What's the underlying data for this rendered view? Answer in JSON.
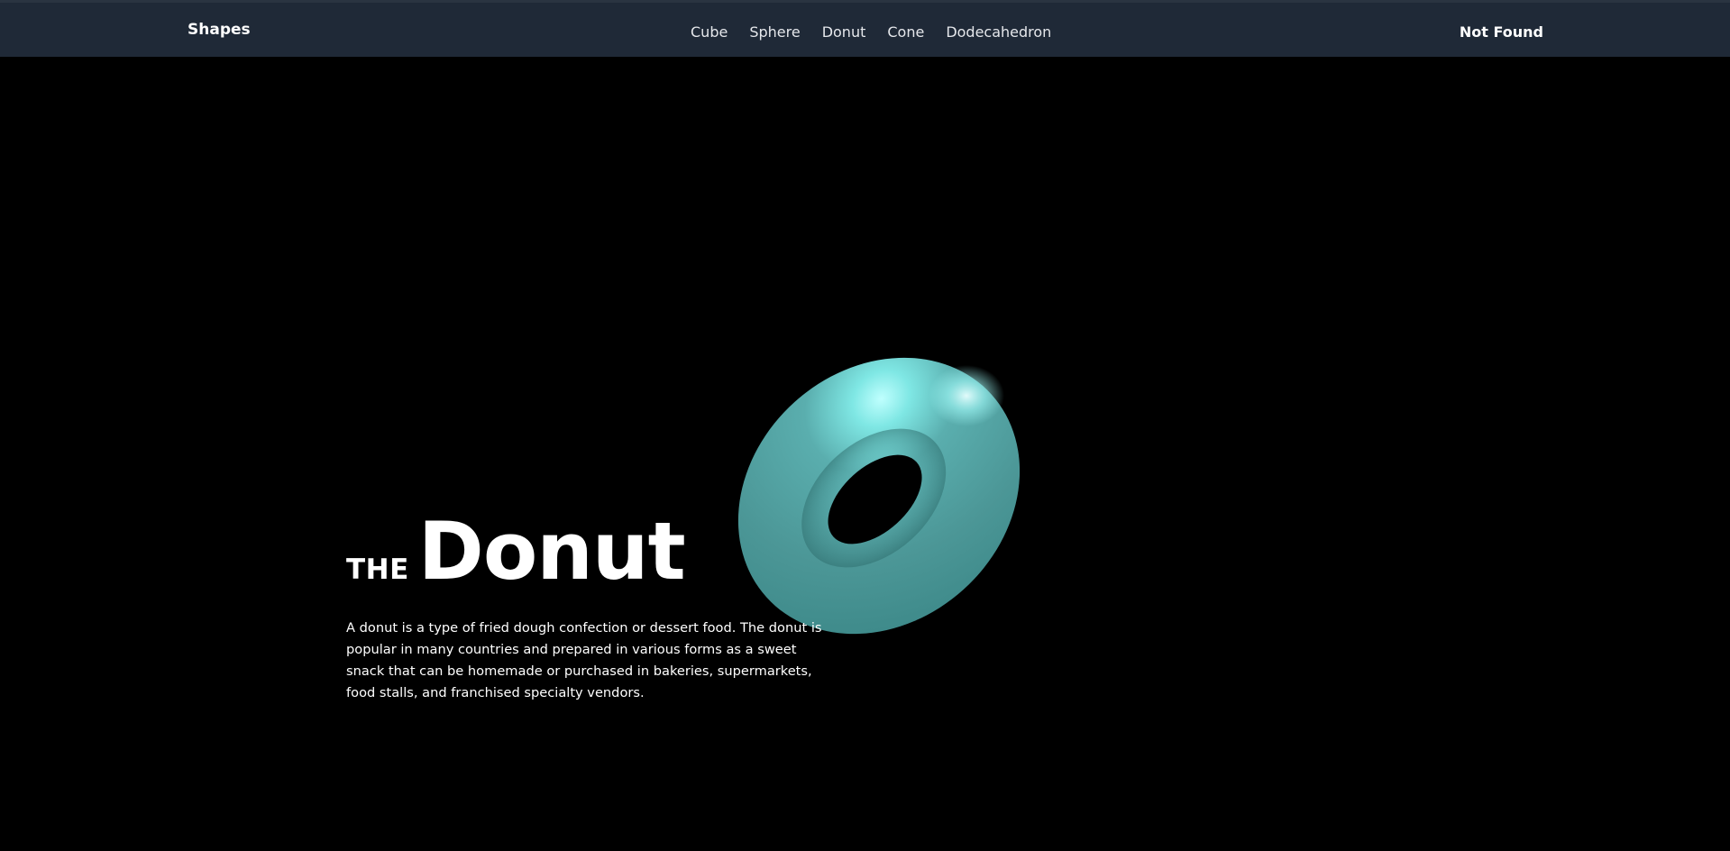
{
  "navbar": {
    "brand": "Shapes",
    "links": [
      {
        "label": "Cube"
      },
      {
        "label": "Sphere"
      },
      {
        "label": "Donut"
      },
      {
        "label": "Cone"
      },
      {
        "label": "Dodecahedron"
      }
    ],
    "right_label": "Not Found"
  },
  "hero": {
    "title_prefix": "THE",
    "title": "Donut",
    "description": "A donut is a type of fried dough confection or dessert food. The donut is popular in many countries and prepared in various forms as a sweet snack that can be homemade or purchased in bakeries, supermarkets, food stalls, and franchised specialty vendors."
  },
  "colors": {
    "navbar_bg": "#1f2937",
    "page_bg": "#000000",
    "donut_base": "#4f9c9c",
    "donut_highlight": "#9ff7f5"
  },
  "icons": {
    "hero_shape": "torus-3d-icon"
  }
}
